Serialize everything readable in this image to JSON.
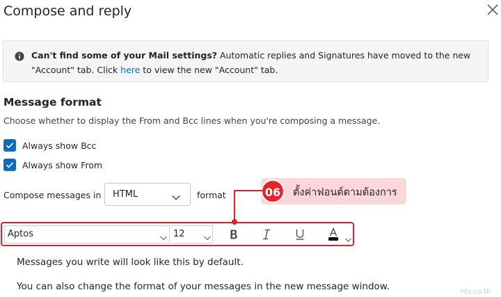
{
  "dialog": {
    "title": "Compose and reply",
    "close_icon": "close-icon"
  },
  "banner": {
    "icon": "info-icon",
    "bold": "Can't find some of your Mail settings?",
    "text1": " Automatic replies and Signatures have moved to the new",
    "text2": "\"Account\" tab. Click ",
    "link": "here",
    "text3": " to view the new \"Account\" tab."
  },
  "message_format": {
    "heading": "Message format",
    "description": "Choose whether to display the From and Bcc lines when you're composing a message.",
    "checkboxes": [
      {
        "label": "Always show Bcc",
        "checked": true
      },
      {
        "label": "Always show From",
        "checked": true
      }
    ],
    "compose_label": "Compose messages in",
    "compose_value": "HTML",
    "format_label": "format"
  },
  "callout": {
    "number": "06",
    "text": "ตั้งค่าฟอนต์ตามต้องการ",
    "color": "#e8232b",
    "bg": "#fbd7da"
  },
  "toolbar": {
    "font": "Aptos",
    "size": "12",
    "icons": [
      "bold-icon",
      "italic-icon",
      "underline-icon",
      "font-color-icon"
    ]
  },
  "preview": {
    "line1": "Messages you write will look like this by default.",
    "line2": "You can also change the format of your messages in the new message window."
  },
  "watermark": "nts.co.th"
}
